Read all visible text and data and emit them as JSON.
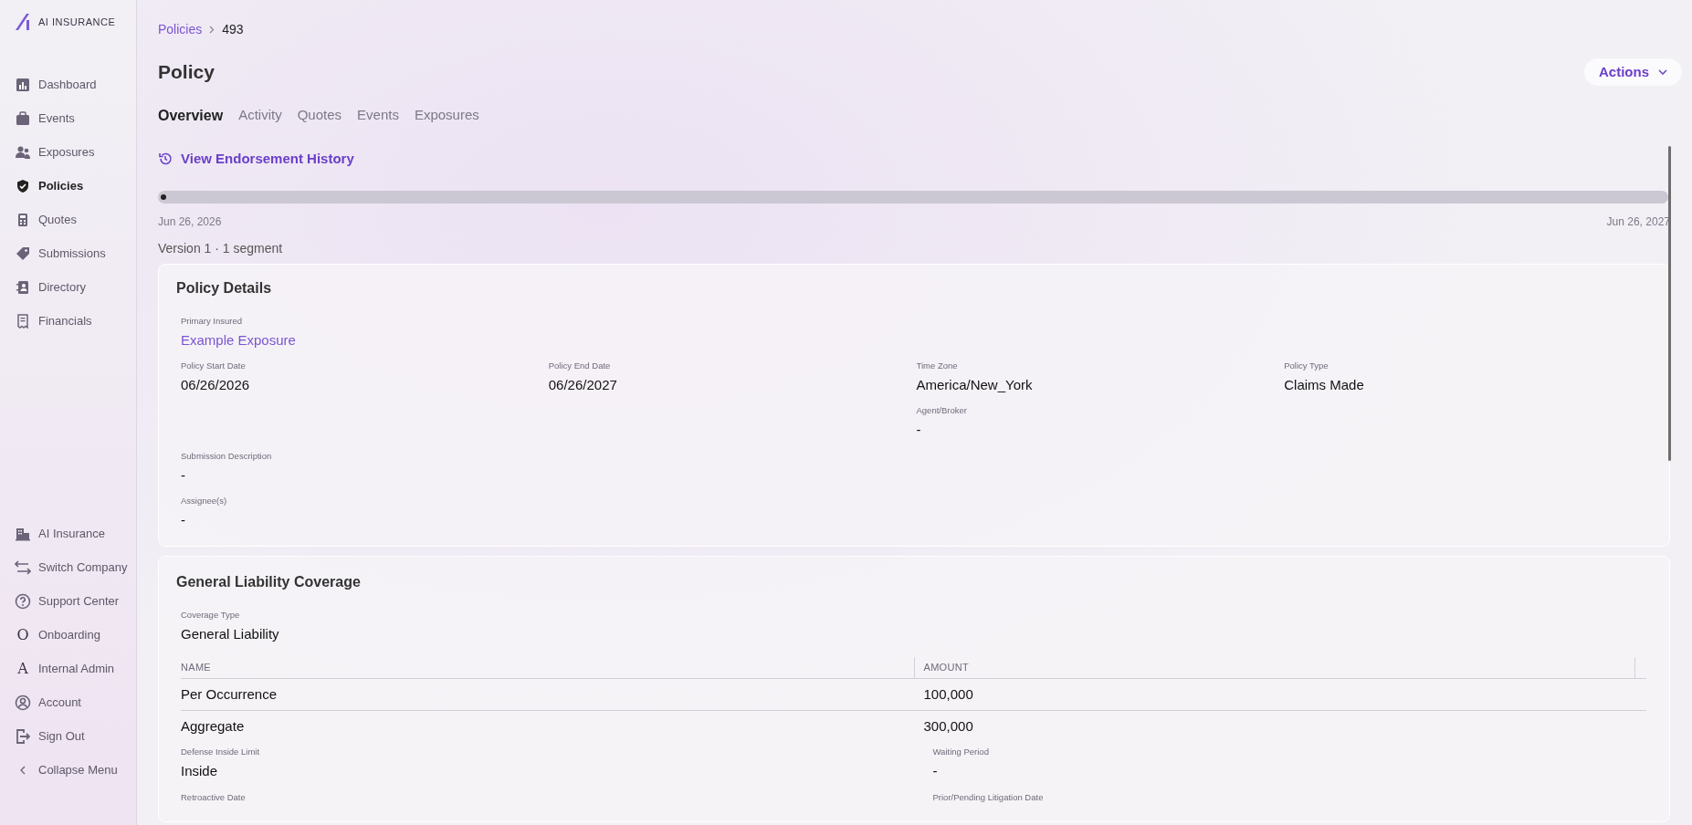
{
  "sidebar": {
    "logo_text": "AI INSURANCE",
    "items": [
      {
        "label": "Dashboard",
        "selected": false
      },
      {
        "label": "Events",
        "selected": false
      },
      {
        "label": "Exposures",
        "selected": false
      },
      {
        "label": "Policies",
        "selected": true
      },
      {
        "label": "Quotes",
        "selected": false
      },
      {
        "label": "Submissions",
        "selected": false
      },
      {
        "label": "Directory",
        "selected": false
      },
      {
        "label": "Financials",
        "selected": false
      }
    ],
    "bottom_items": [
      {
        "label": "AI Insurance"
      },
      {
        "label": "Switch Company"
      },
      {
        "label": "Support Center"
      },
      {
        "label": "Onboarding",
        "glyph": "O"
      },
      {
        "label": "Internal Admin",
        "glyph": "A"
      },
      {
        "label": "Account"
      },
      {
        "label": "Sign Out"
      },
      {
        "label": "Collapse Menu"
      }
    ]
  },
  "breadcrumb": [
    {
      "label": "Policies"
    },
    {
      "label": "493"
    }
  ],
  "page_title": "Policy",
  "actions_button": "Actions",
  "tabs": [
    {
      "label": "Overview",
      "selected": true
    },
    {
      "label": "Activity",
      "selected": false
    },
    {
      "label": "Quotes",
      "selected": false
    },
    {
      "label": "Events",
      "selected": false
    },
    {
      "label": "Exposures",
      "selected": false
    }
  ],
  "endorsement_link": "View Endorsement History",
  "timeline": {
    "start": "Jun 26, 2026",
    "end": "Jun 26, 2027",
    "version": "Version 1 · 1 segment"
  },
  "policy_details": {
    "title": "Policy Details",
    "primary_insured": {
      "label": "Primary Insured",
      "value": "Example Exposure"
    },
    "fields": [
      {
        "label": "Policy Start Date",
        "value": "06/26/2026"
      },
      {
        "label": "Policy End Date",
        "value": "06/26/2027"
      },
      {
        "label": "Time Zone",
        "value": "America/New_York"
      },
      {
        "label": "Policy Type",
        "value": "Claims Made"
      }
    ],
    "agent_broker": {
      "label": "Agent/Broker",
      "value": "-"
    },
    "submission_description": {
      "label": "Submission Description",
      "value": "-"
    },
    "assignees": {
      "label": "Assignee(s)",
      "value": "-"
    }
  },
  "coverage": {
    "title": "General Liability Coverage",
    "coverage_type": {
      "label": "Coverage Type",
      "value": "General Liability"
    },
    "table": {
      "columns": [
        "NAME",
        "AMOUNT"
      ],
      "rows": [
        [
          "Per Occurrence",
          "100,000"
        ],
        [
          "Aggregate",
          "300,000"
        ]
      ]
    },
    "fields": [
      {
        "label": "Defense Inside Limit",
        "value": "Inside"
      },
      {
        "label": "Waiting Period",
        "value": "-"
      },
      {
        "label": "Retroactive Date"
      },
      {
        "label": "Prior/Pending Litigation Date"
      }
    ]
  }
}
